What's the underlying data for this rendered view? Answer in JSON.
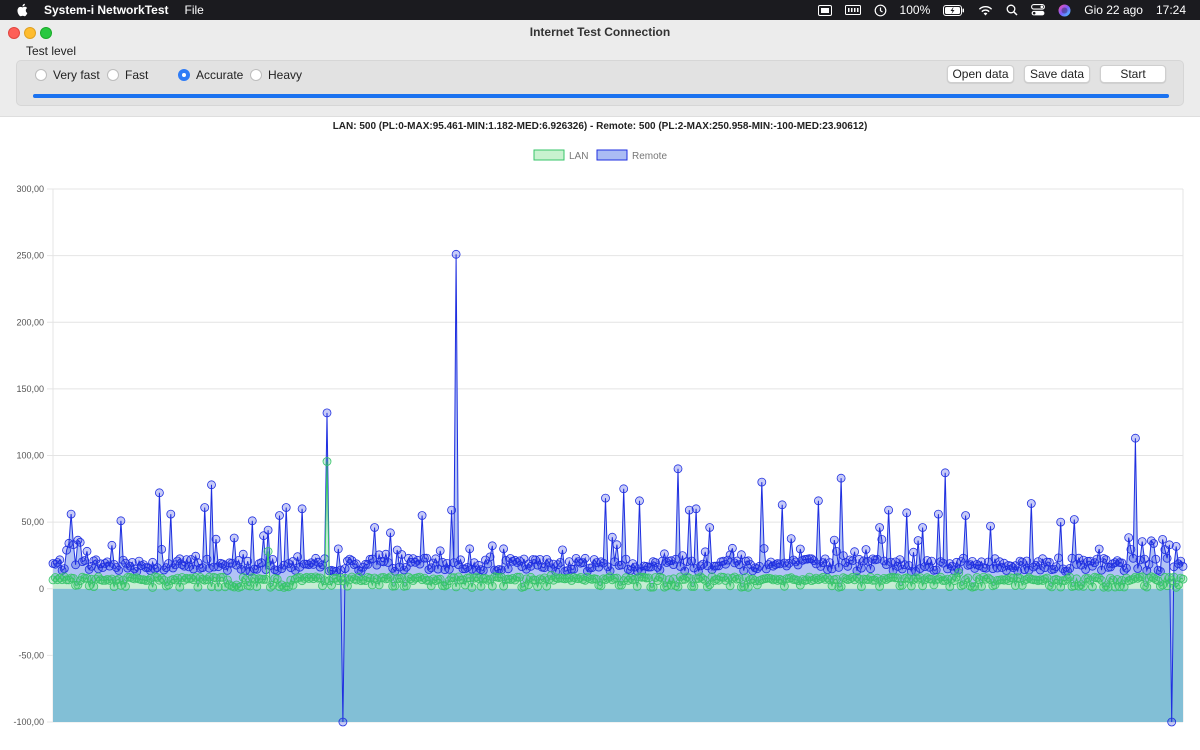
{
  "menubar": {
    "app_name": "System-i NetworkTest",
    "menus": [
      "File"
    ],
    "battery": "100%",
    "date": "Gio 22 ago",
    "time": "17:24"
  },
  "window": {
    "title": "Internet Test Connection"
  },
  "toolbar": {
    "group_label": "Test level",
    "levels": [
      {
        "label": "Very fast",
        "selected": false
      },
      {
        "label": "Fast",
        "selected": false
      },
      {
        "label": "Accurate",
        "selected": true
      },
      {
        "label": "Heavy",
        "selected": false
      }
    ],
    "open_label": "Open data",
    "save_label": "Save data",
    "start_label": "Start",
    "progress": 1.0
  },
  "colors": {
    "lan": "#37c46a",
    "lan_fill": "#c8f2cf",
    "remote": "#1f2fe0",
    "remote_fill": "#aabcf4",
    "below_zero_fill": "#82bfd6",
    "accent": "#1a72f0"
  },
  "chart_data": {
    "type": "line",
    "title": "LAN: 500 (PL:0-MAX:95.461-MIN:1.182-MED:6.926326) - Remote: 500 (PL:2-MAX:250.958-MIN:-100-MED:23.90612)",
    "xlabel": "",
    "ylabel": "",
    "ylim": [
      -100,
      300
    ],
    "yticks": [
      "-100,00",
      "-50,00",
      "0",
      "50,00",
      "100,00",
      "150,00",
      "200,00",
      "250,00",
      "300,00"
    ],
    "ytick_values": [
      -100,
      -50,
      0,
      50,
      100,
      150,
      200,
      250,
      300
    ],
    "grid": true,
    "legend": "top-center",
    "n_points": 500,
    "series": [
      {
        "name": "LAN",
        "baseline": 7,
        "peaks": [
          [
            121,
            95.5
          ],
          [
            45,
            9
          ],
          [
            95,
            28
          ],
          [
            220,
            10
          ],
          [
            400,
            12
          ]
        ]
      },
      {
        "name": "Remote",
        "baseline": 20,
        "peaks": [
          [
            8,
            56
          ],
          [
            30,
            51
          ],
          [
            47,
            72
          ],
          [
            52,
            56
          ],
          [
            67,
            61
          ],
          [
            70,
            78
          ],
          [
            88,
            51
          ],
          [
            95,
            44
          ],
          [
            100,
            55
          ],
          [
            103,
            61
          ],
          [
            110,
            60
          ],
          [
            121,
            132
          ],
          [
            128,
            -100
          ],
          [
            142,
            46
          ],
          [
            149,
            42
          ],
          [
            163,
            55
          ],
          [
            176,
            59
          ],
          [
            178,
            251
          ],
          [
            244,
            68
          ],
          [
            252,
            75
          ],
          [
            259,
            66
          ],
          [
            276,
            90
          ],
          [
            281,
            59
          ],
          [
            284,
            60
          ],
          [
            290,
            46
          ],
          [
            313,
            80
          ],
          [
            322,
            63
          ],
          [
            338,
            66
          ],
          [
            348,
            83
          ],
          [
            365,
            46
          ],
          [
            369,
            59
          ],
          [
            377,
            57
          ],
          [
            384,
            46
          ],
          [
            391,
            56
          ],
          [
            394,
            87
          ],
          [
            403,
            55
          ],
          [
            414,
            47
          ],
          [
            432,
            64
          ],
          [
            445,
            50
          ],
          [
            451,
            52
          ],
          [
            478,
            113
          ],
          [
            485,
            36
          ],
          [
            490,
            37
          ],
          [
            494,
            -100
          ]
        ]
      }
    ]
  }
}
